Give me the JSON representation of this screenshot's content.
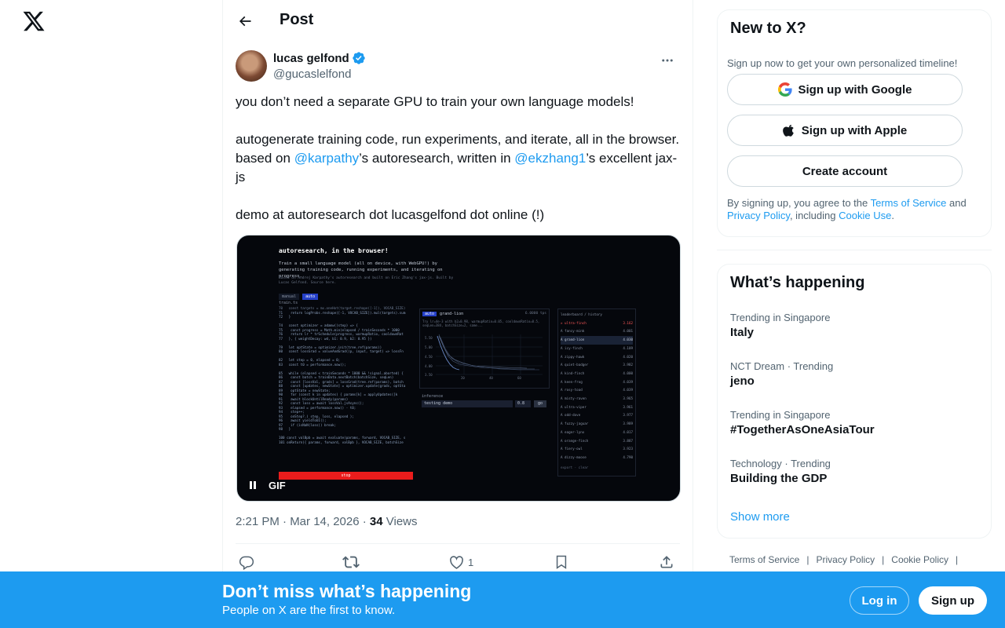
{
  "brand": {
    "logo_icon": "x-logo-icon"
  },
  "post_header": {
    "title": "Post",
    "back_icon": "arrow-left-icon"
  },
  "author": {
    "name": "lucas gelfond",
    "handle": "@gucaslelfond",
    "verified": true
  },
  "tweet": {
    "para1": "you don’t need a separate GPU to train your own language models!",
    "para2_a": "autogenerate training code, run experiments, and iterate, all in the browser. based on ",
    "mention1": "@karpathy",
    "para2_b": "’s autoresearch, written in ",
    "mention2": "@ekzhang1",
    "para2_c": "’s excellent jax-js",
    "para3": "demo at autoresearch dot lucasgelfond dot online (!)"
  },
  "media": {
    "badge": "GIF",
    "title": "autoresearch, in the browser!",
    "desc": "Train a small language model (all on device, with WebGPU!) by generating training code, running experiments, and iterating on progress.",
    "credit": "Based on Andrej Karpathy's autoresearch and built on Eric Zhang's jax-js. Built by Lucas Gelfond. Source here.",
    "mode_manual": "manual",
    "mode_auto": "auto",
    "file_label": "train.ts",
    "run_tag": "auto",
    "run_name": "grand-lion",
    "run_speed": "6.0000 tps",
    "inference_label": "inference",
    "inference_input": "testing demo",
    "inference_temp": "0.8",
    "inference_go": "go",
    "stop_label": "stop",
    "history_title": "leaderboard / history",
    "history_items": [
      "ultra-finch",
      "fancy-mink",
      "grand-lion",
      "icy-finch",
      "zippy-hawk",
      "quiet-badger",
      "kind-finch",
      "keen-frog",
      "rosy-toad",
      "misty-raven",
      "ultra-viper",
      "odd-dove",
      "fuzzy-jaguar",
      "eager-lynx",
      "orange-finch",
      "fiery-owl",
      "dizzy-moose"
    ],
    "history_scores": [
      "3.162",
      "4.001",
      "4.030",
      "4.109",
      "4.020",
      "3.982",
      "4.000",
      "4.039",
      "4.039",
      "3.965",
      "3.961",
      "3.977",
      "3.989",
      "4.017",
      "3.887",
      "3.923",
      "4.790"
    ],
    "export_label": "export · clear"
  },
  "meta": {
    "time": "2:21 PM · Mar 14, 2026 · ",
    "views_count": "34",
    "views_label": " Views"
  },
  "actions": {
    "reply_icon": "reply-icon",
    "repost_icon": "repost-icon",
    "like_icon": "heart-icon",
    "like_count": "1",
    "bookmark_icon": "bookmark-icon",
    "share_icon": "share-icon"
  },
  "signup_card": {
    "title": "New to X?",
    "subtitle": "Sign up now to get your own personalized timeline!",
    "google": "Sign up with Google",
    "apple": "Sign up with Apple",
    "create": "Create account",
    "legal_a": "By signing up, you agree to the ",
    "terms": "Terms of Service",
    "legal_b": " and ",
    "privacy": "Privacy Policy",
    "legal_c": ", including ",
    "cookie": "Cookie Use",
    "legal_d": "."
  },
  "trends": {
    "title": "What’s happening",
    "items": [
      {
        "context": "Trending in Singapore",
        "name": "Italy"
      },
      {
        "context": "NCT Dream · Trending",
        "name": "jeno"
      },
      {
        "context": "Trending in Singapore",
        "name": "#TogetherAsOneAsiaTour"
      },
      {
        "context": "Technology · Trending",
        "name": "Building the GDP"
      }
    ],
    "show_more": "Show more"
  },
  "footer": {
    "links": [
      "Terms of Service",
      "Privacy Policy",
      "Cookie Policy"
    ]
  },
  "banner": {
    "title": "Don’t miss what’s happening",
    "subtitle": "People on X are the first to know.",
    "login": "Log in",
    "signup": "Sign up"
  },
  "colors": {
    "accent": "#1d9bf0",
    "text": "#0f1419",
    "muted": "#536471",
    "border": "#eff3f4",
    "stop_red": "#ea1c1c"
  }
}
